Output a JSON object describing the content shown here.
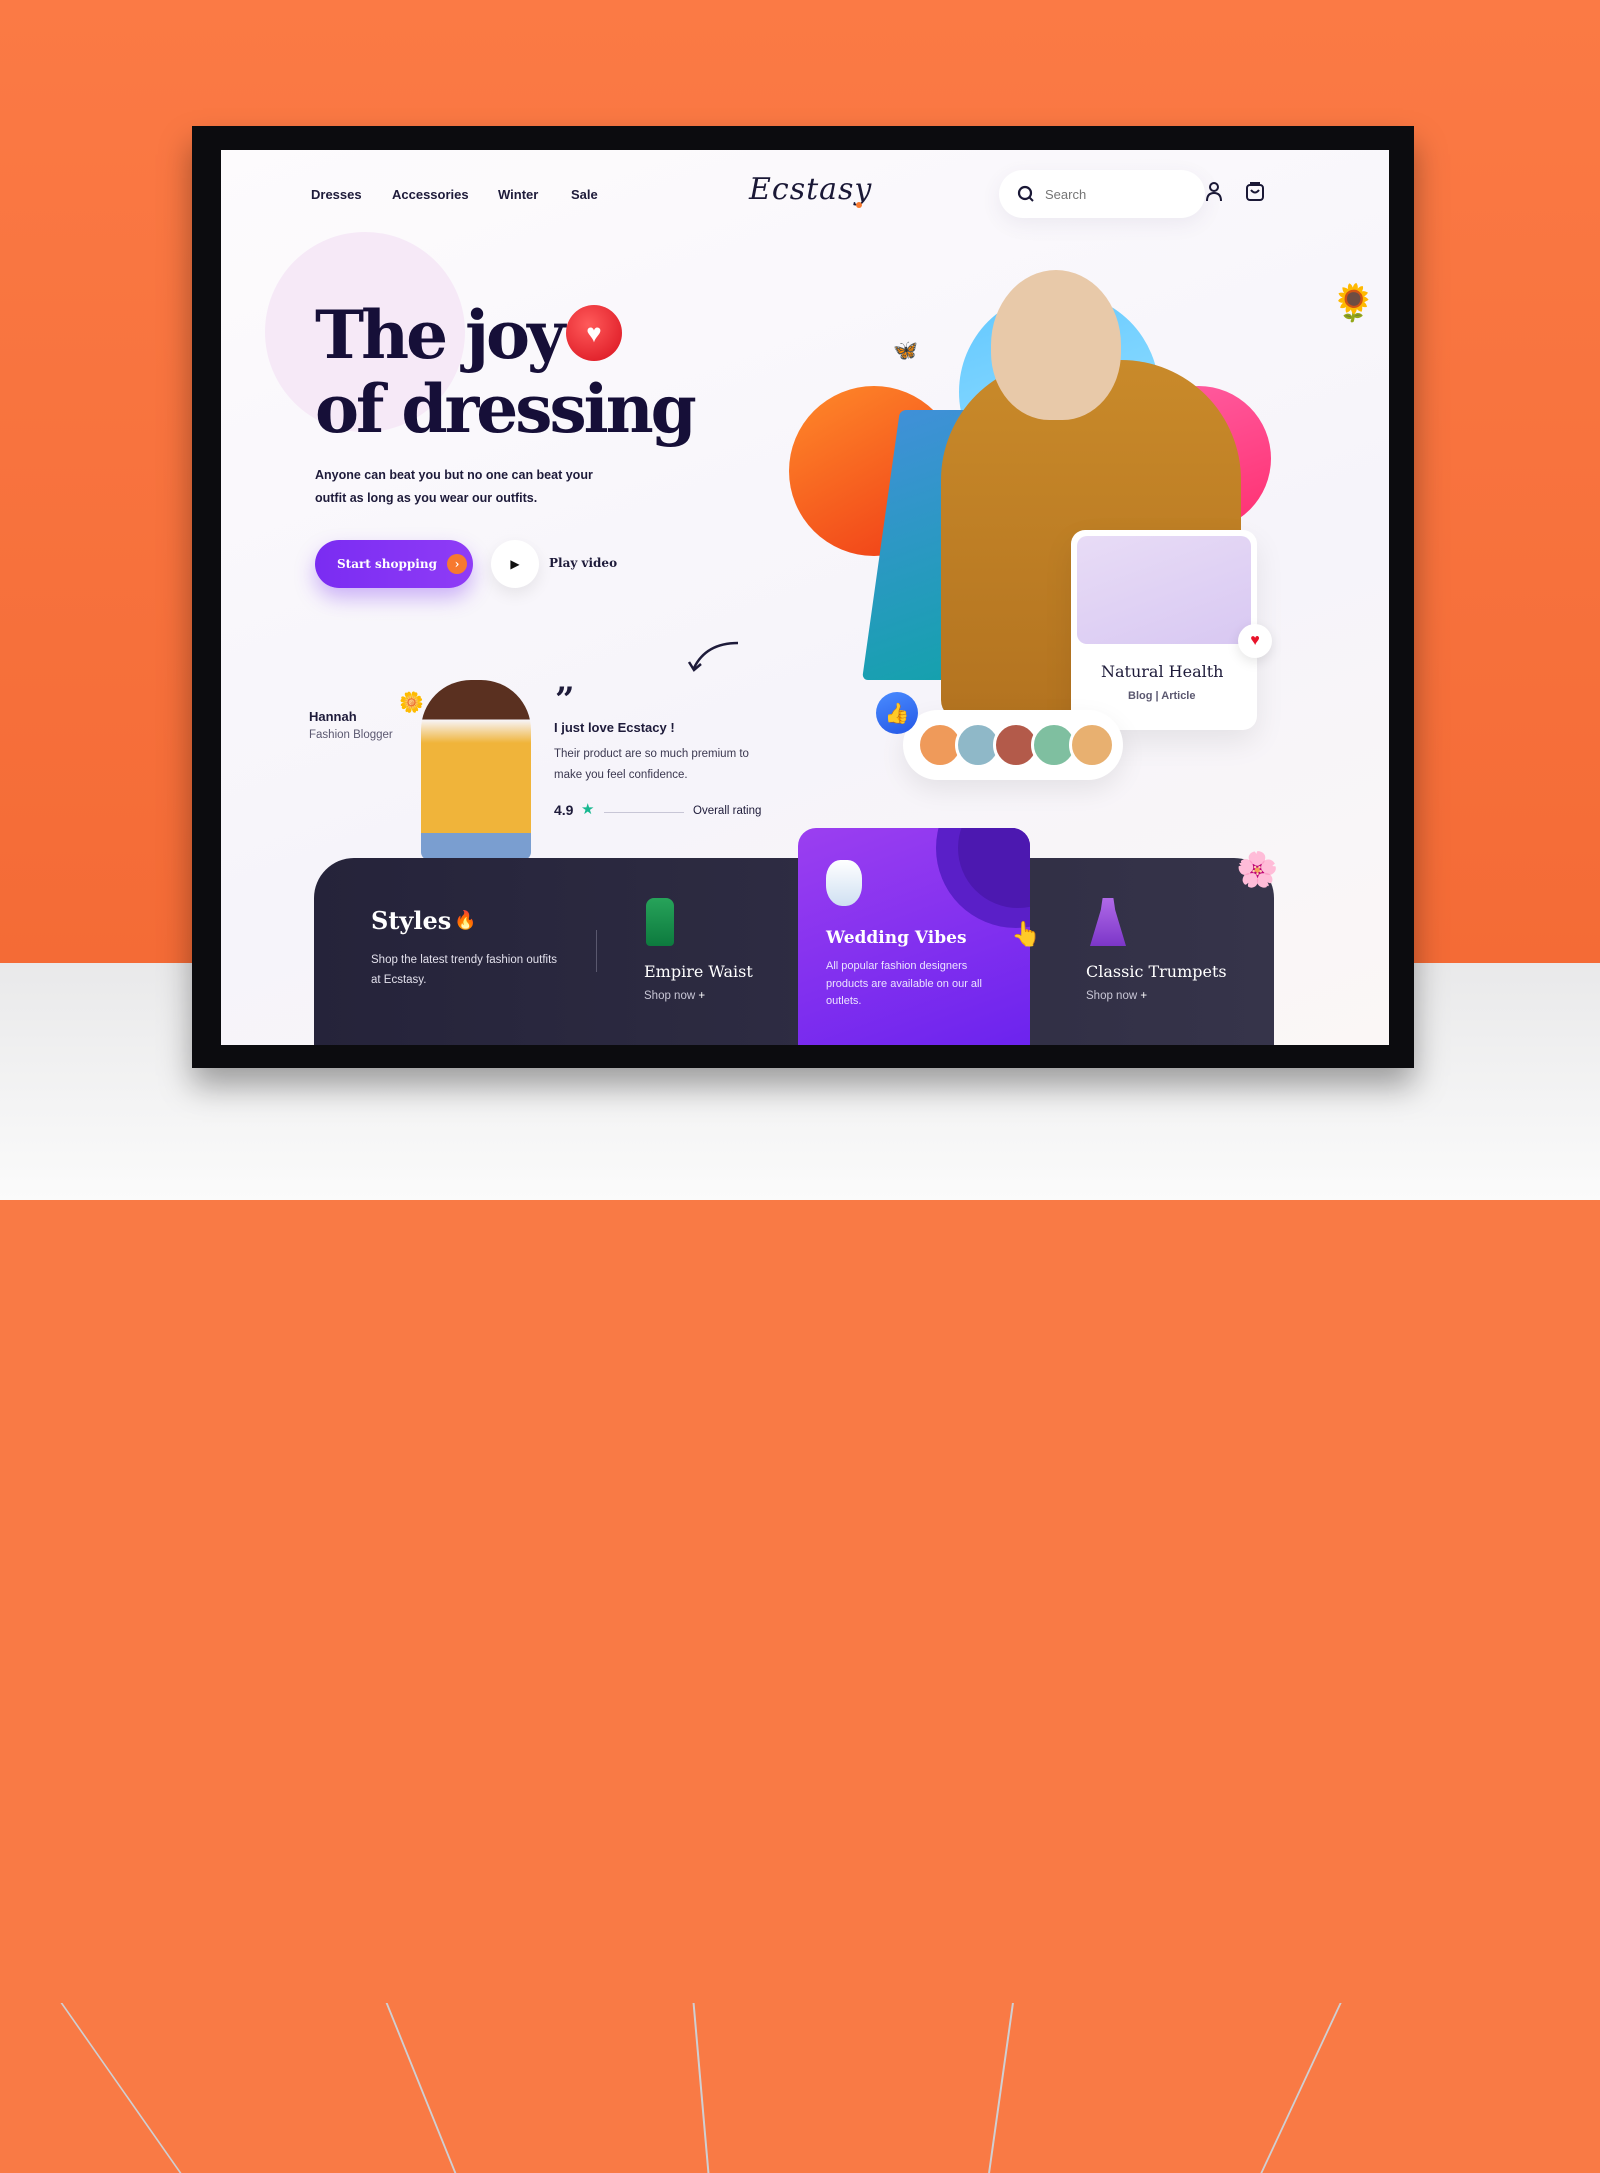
{
  "nav": {
    "items": [
      "Dresses",
      "Accessories",
      "Winter",
      "Sale"
    ],
    "logo": "Ecstasy",
    "search_placeholder": "Search"
  },
  "hero": {
    "title_line1": "The joy",
    "title_line2": "of dressing",
    "subtitle": "Anyone can beat you but no one can beat your outfit as long as you wear our outfits.",
    "start_shopping": "Start shopping",
    "play_video": "Play video"
  },
  "testimonial": {
    "name": "Hannah",
    "role": "Fashion Blogger",
    "quote_title": "I just love Ecstacy !",
    "quote_text": "Their product are so much premium to make you feel confidence.",
    "rating": "4.9",
    "rating_label": "Overall rating"
  },
  "blog_card": {
    "title": "Natural Health",
    "tag1": "Blog",
    "tag2": "Article"
  },
  "styles": {
    "title": "Styles",
    "description": "Shop the latest trendy fashion outfits at Ecstasy.",
    "items": [
      {
        "name": "Empire Waist",
        "action": "Shop now"
      },
      {
        "name": "Wedding Vibes",
        "description": "All popular fashion designers products are available on our all outlets."
      },
      {
        "name": "Classic Trumpets",
        "action": "Shop now"
      }
    ]
  },
  "colors": {
    "accent": "#7a2cf2",
    "orange": "#f7792f",
    "dark": "#160f38",
    "card_dark": "#2b2940"
  }
}
